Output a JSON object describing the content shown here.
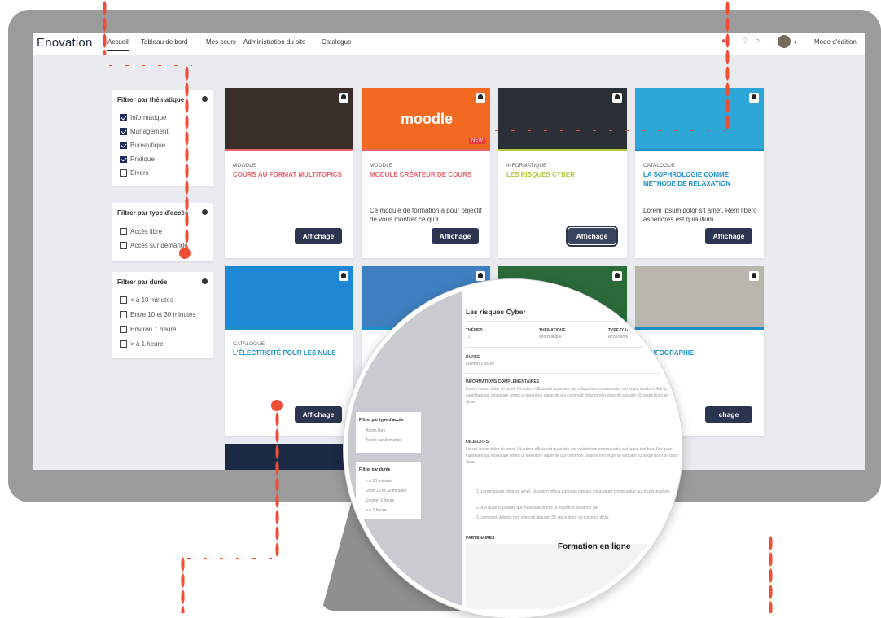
{
  "navbar": {
    "brand": "Enovation",
    "links": [
      "Accueil",
      "Tableau de bord",
      "Mes cours",
      "Administration du site",
      "Catalogue"
    ],
    "mode": "Mode d'édition"
  },
  "filters": {
    "thematique": {
      "title": "Filtrer par thématique",
      "options": [
        {
          "label": "Informatique",
          "checked": true
        },
        {
          "label": "Management",
          "checked": true
        },
        {
          "label": "Bureautique",
          "checked": true
        },
        {
          "label": "Pratique",
          "checked": true
        },
        {
          "label": "Divers",
          "checked": false
        }
      ]
    },
    "acces": {
      "title": "Filtrer par type d'accès",
      "options": [
        {
          "label": "Accès libre",
          "checked": false
        },
        {
          "label": "Accès sur demande",
          "checked": false
        }
      ]
    },
    "duree": {
      "title": "Filtrer par durée",
      "options": [
        {
          "label": "< à 10 minutes",
          "checked": false
        },
        {
          "label": "Entre 10 et 30 minutes",
          "checked": false
        },
        {
          "label": "Environ 1 heure",
          "checked": false
        },
        {
          "label": "> à 1 heure",
          "checked": false
        }
      ]
    }
  },
  "cards": [
    {
      "category": "MOODLE",
      "title": "COURS AU FORMAT MULTITOPICS",
      "desc": "",
      "button": "Affichage",
      "color": "#e8636b",
      "strip": "#e8636b",
      "img": "#3a2e2a"
    },
    {
      "category": "MOODLE",
      "title": "MODULE CRÉATEUR DE COURS",
      "desc": "Ce module de formation à pour objectif de vous montrer ce qu'il",
      "button": "Affichage",
      "color": "#e8636b",
      "strip": "#e8636b",
      "img": "#f26a21",
      "img_text": "moodle",
      "img_badge": "NEW"
    },
    {
      "category": "INFORMATIQUE",
      "title": "LES RISQUES CYBER",
      "desc": "",
      "button": "Affichage",
      "color": "#b6c73a",
      "strip": "#b6c73a",
      "img": "#2b2f36"
    },
    {
      "category": "CATALOGUE",
      "title": "LA SOPHROLOGIE COMME MÉTHODE DE RELAXATION",
      "desc": "Lorem ipsum dolor sit amet. Rem libero asperiores est quia illum",
      "button": "Affichage",
      "color": "#1a8fc9",
      "strip": "#1a8fc9",
      "img": "#2fa6d8"
    },
    {
      "category": "CATALOGUE",
      "title": "L'ÉLECTRICITÉ POUR LES NULS",
      "desc": "",
      "button": "Affichage",
      "color": "#1a8fc9",
      "strip": "#1a8fc9",
      "img": "#1e88d4"
    },
    {
      "category": "",
      "title": "",
      "desc": "",
      "button": "",
      "color": "#1a8fc9",
      "strip": "#1a8fc9",
      "img": "#3e7fbf"
    },
    {
      "category": "",
      "title": "",
      "desc": "",
      "button": "",
      "color": "#1a8fc9",
      "strip": "#1a8fc9",
      "img": "#2b6b3a"
    },
    {
      "category": "",
      "title": "L'INFOGRAPHIE",
      "desc": "",
      "button": "chage",
      "color": "#1a8fc9",
      "strip": "#1a8fc9",
      "img": "#b9b6ae"
    }
  ],
  "zoom": {
    "title": "Les risques Cyber",
    "themes_label": "THÈMES",
    "themes_value": "T2",
    "thematique_label": "THÉMATIQUE",
    "thematique_value": "Informatique",
    "acces_label": "TYPE D'ACCÈS",
    "acces_value": "Accès libre",
    "duree_label": "DURÉE",
    "duree_value": "Environ 1 heure",
    "info_label": "INFORMATIONS COMPLÉMENTAIRES",
    "info_text": "Lorem ipsum dolor sit amet. Ut autem officia aut quas iste aut voluptatum consequatur aut fugiat incidunt. Aut quae cupiditate qui molestiae omnis ut inventore sapiente qui commodi dolores non eligendi aliquam 33 sequi dolor sit ducimus dicta.",
    "objectifs_label": "OBJECTIFS",
    "objectifs_text": "Lorem ipsum dolor sit amet. Ut autem officia aut quas iste aut voluptatum consequatur aut fugiat incidunt. Aut quae cupiditate qui molestiae omnis ut inventore sapiente qui commodi dolores non eligendi aliquam 33 sequi dolor sit ducimus dicta.",
    "list": [
      "1. Lorem ipsum dolor sit amet. Ut autem officia aut quas iste aut voluptatum consequatur aut fugiat incidunt.",
      "2. Aut quae cupiditate qui molestiae omnis ut inventore sapiente qui",
      "3. commodi dolores non eligendi aliquam 33 sequi dolor sit ducimus dicta."
    ],
    "partenaires_label": "PARTENAIRES",
    "banner_text": "Formation en ligne",
    "side_filters": [
      "Filtrer par type d'accès",
      "Accès libre",
      "Accès sur demande",
      "Filtrer par durée",
      "< à 10 minutes",
      "Entre 10 et 30 minutes",
      "Environ 1 heure",
      "> à 1 heure"
    ]
  },
  "accent": "#f04e37"
}
